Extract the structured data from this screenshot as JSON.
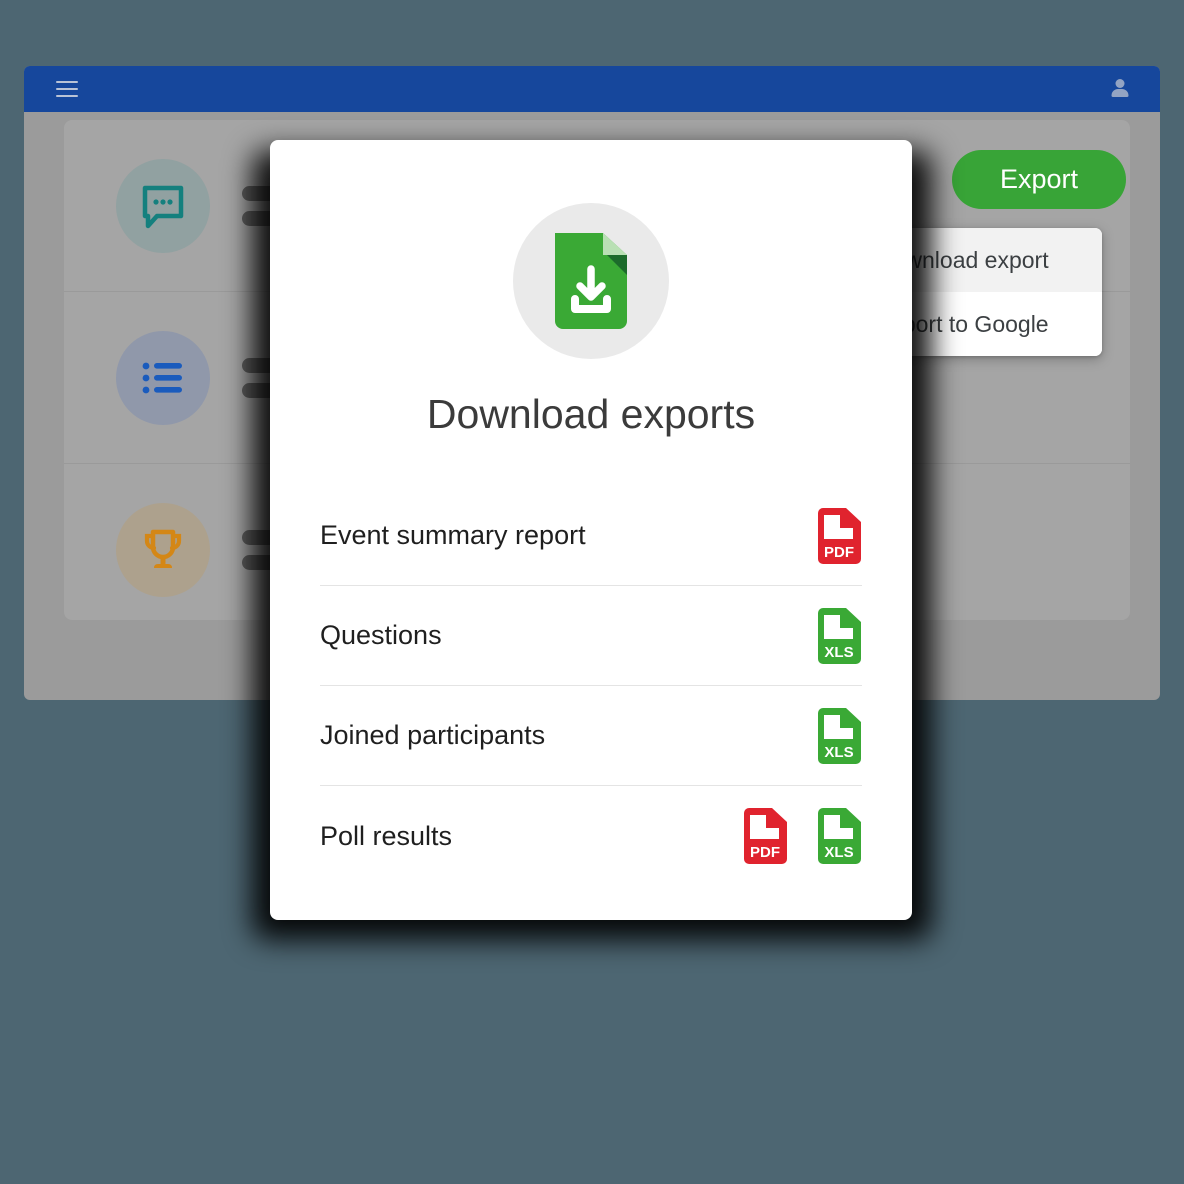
{
  "background_app": {
    "header": {
      "menu_icon": "hamburger-icon",
      "account_icon": "person-avatar-icon"
    },
    "rows": [
      {
        "icon": "chat-bubble-icon",
        "icon_color": "#14807e"
      },
      {
        "icon": "bulleted-list-icon",
        "icon_color": "#1a5bbd"
      },
      {
        "icon": "trophy-icon",
        "icon_color": "#d48716"
      }
    ],
    "export_button_label": "Export"
  },
  "dropdown": {
    "items": [
      {
        "label": "Download export",
        "icon": "download-icon",
        "highlighted": true
      },
      {
        "label": "Export to Google",
        "icon": "google-g-icon",
        "highlighted": false
      }
    ]
  },
  "modal": {
    "hero_icon": "document-download-icon",
    "title": "Download exports",
    "rows": [
      {
        "label": "Event summary report",
        "formats": [
          "PDF"
        ]
      },
      {
        "label": "Questions",
        "formats": [
          "XLS"
        ]
      },
      {
        "label": "Joined participants",
        "formats": [
          "XLS"
        ]
      },
      {
        "label": "Poll results",
        "formats": [
          "PDF",
          "XLS"
        ]
      }
    ]
  },
  "format_labels": {
    "pdf": "PDF",
    "xls": "XLS"
  },
  "colors": {
    "page_background": "#4d6672",
    "app_header": "#16479c",
    "export_green": "#38a437",
    "pdf_red": "#e0232e",
    "xls_green": "#3aa935",
    "hero_green": "#3aa935"
  }
}
